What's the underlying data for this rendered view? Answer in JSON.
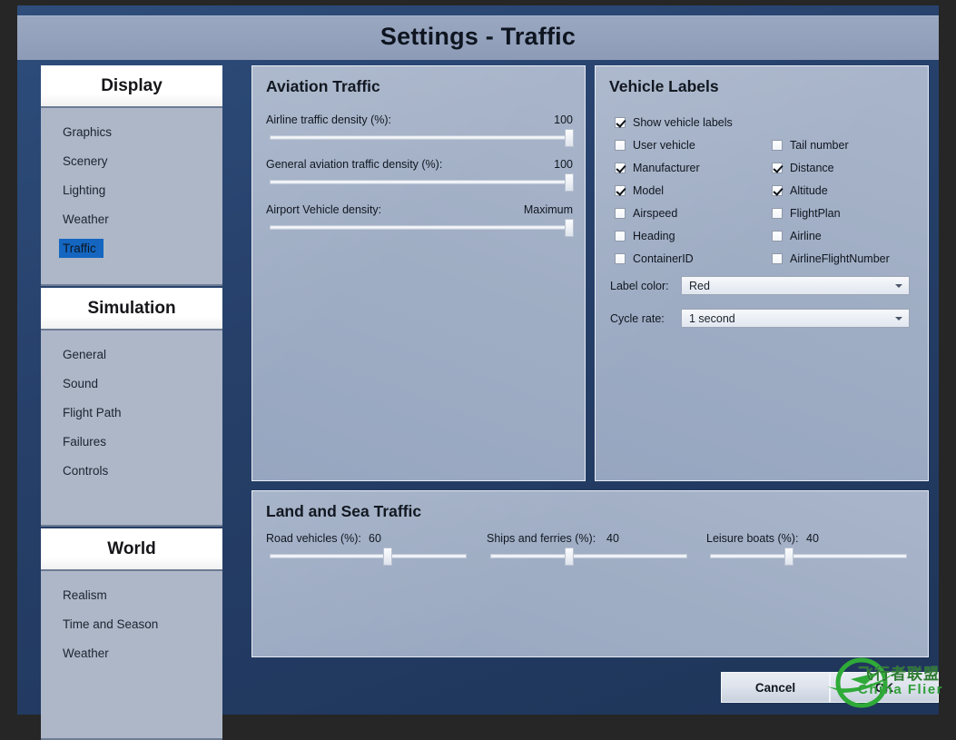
{
  "window": {
    "title": "Settings - Traffic"
  },
  "sidebar": {
    "groups": [
      {
        "header": "Display",
        "items": [
          {
            "label": "Graphics",
            "selected": false
          },
          {
            "label": "Scenery",
            "selected": false
          },
          {
            "label": "Lighting",
            "selected": false
          },
          {
            "label": "Weather",
            "selected": false
          },
          {
            "label": "Traffic",
            "selected": true
          }
        ]
      },
      {
        "header": "Simulation",
        "items": [
          {
            "label": "General",
            "selected": false
          },
          {
            "label": "Sound",
            "selected": false
          },
          {
            "label": "Flight Path",
            "selected": false
          },
          {
            "label": "Failures",
            "selected": false
          },
          {
            "label": "Controls",
            "selected": false
          }
        ]
      },
      {
        "header": "World",
        "items": [
          {
            "label": "Realism",
            "selected": false
          },
          {
            "label": "Time and Season",
            "selected": false
          },
          {
            "label": "Weather",
            "selected": false
          }
        ]
      }
    ]
  },
  "aviation": {
    "title": "Aviation Traffic",
    "sliders": [
      {
        "label": "Airline traffic density (%):",
        "value": "100",
        "percent": 100
      },
      {
        "label": "General aviation traffic density (%):",
        "value": "100",
        "percent": 100
      },
      {
        "label": "Airport Vehicle density:",
        "value": "Maximum",
        "percent": 100
      }
    ]
  },
  "vehicle_labels": {
    "title": "Vehicle Labels",
    "master": {
      "label": "Show vehicle labels",
      "checked": true
    },
    "left_column": [
      {
        "label": "User vehicle",
        "checked": false
      },
      {
        "label": "Manufacturer",
        "checked": true
      },
      {
        "label": "Model",
        "checked": true
      },
      {
        "label": "Airspeed",
        "checked": false
      },
      {
        "label": "Heading",
        "checked": false
      },
      {
        "label": "ContainerID",
        "checked": false
      }
    ],
    "right_column": [
      {
        "label": "Tail number",
        "checked": false
      },
      {
        "label": "Distance",
        "checked": true
      },
      {
        "label": "Altitude",
        "checked": true
      },
      {
        "label": "FlightPlan",
        "checked": false
      },
      {
        "label": "Airline",
        "checked": false
      },
      {
        "label": "AirlineFlightNumber",
        "checked": false
      }
    ],
    "selects": [
      {
        "label": "Label color:",
        "value": "Red"
      },
      {
        "label": "Cycle rate:",
        "value": "1 second"
      }
    ]
  },
  "land_sea": {
    "title": "Land and Sea Traffic",
    "sliders": [
      {
        "label": "Road vehicles (%):",
        "value": "60",
        "percent": 60
      },
      {
        "label": "Ships and ferries (%):",
        "value": "40",
        "percent": 40
      },
      {
        "label": "Leisure boats (%):",
        "value": "40",
        "percent": 40
      }
    ]
  },
  "footer": {
    "cancel_label": "Cancel",
    "ok_label": "OK"
  },
  "watermark": {
    "chinese": "飞行者联盟",
    "english": "China Flier",
    "color": "#31a03a"
  }
}
